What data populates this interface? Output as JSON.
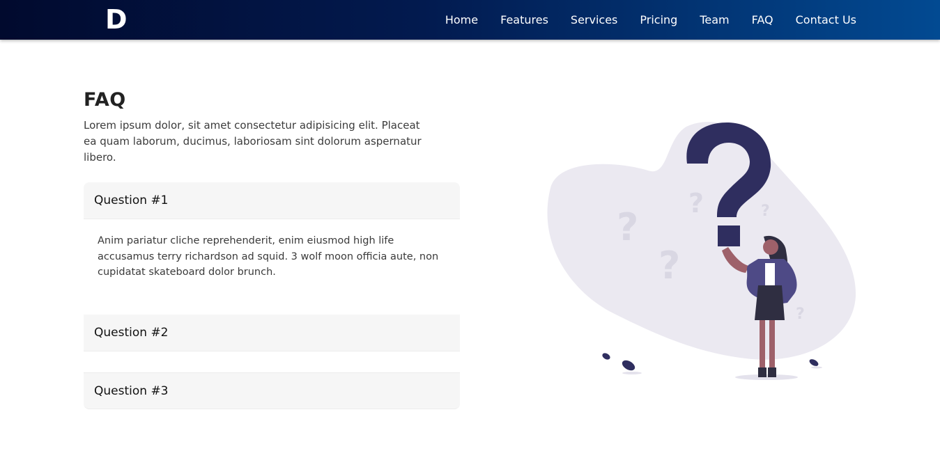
{
  "navbar": {
    "logo": "D",
    "links": [
      "Home",
      "Features",
      "Services",
      "Pricing",
      "Team",
      "FAQ",
      "Contact Us"
    ]
  },
  "faq": {
    "title": "FAQ",
    "intro": "Lorem ipsum dolor, sit amet consectetur adipisicing elit. Placeat ea quam laborum, ducimus, laboriosam sint dolorum aspernatur libero.",
    "items": [
      {
        "question": "Question #1",
        "answer": "Anim pariatur cliche reprehenderit, enim eiusmod high life accusamus terry richardson ad squid. 3 wolf moon officia aute, non cupidatat skateboard dolor brunch.",
        "expanded": true
      },
      {
        "question": "Question #2",
        "expanded": false
      },
      {
        "question": "Question #3",
        "expanded": false
      }
    ]
  },
  "colors": {
    "nav_dark": "#010a2e",
    "nav_light": "#024a92",
    "illustration_primary": "#2f2e5f",
    "illustration_blob": "#ebe9f1"
  },
  "illustration": {
    "icon": "question-mark-woman-illustration"
  }
}
